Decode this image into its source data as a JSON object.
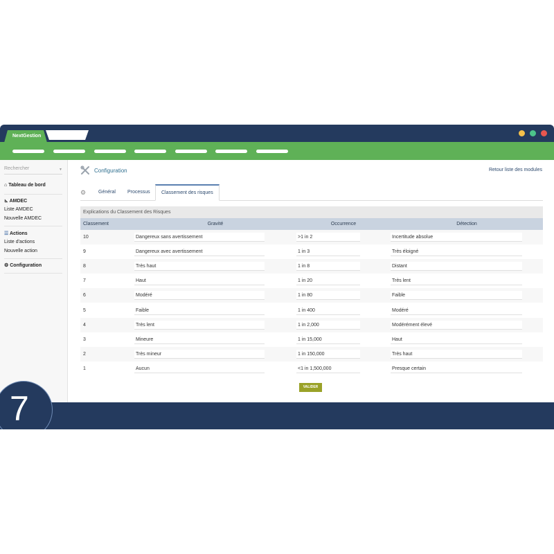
{
  "window": {
    "tab_label": "NextGestion",
    "colors": {
      "frame": "#243a5e",
      "accent": "#5fb157",
      "dot_yellow": "#f5c04a",
      "dot_green": "#4cc48a",
      "dot_red": "#e8574f"
    }
  },
  "sidebar": {
    "search_placeholder": "Rechercher",
    "dashboard": {
      "icon": "home-icon",
      "label": "Tableau de bord"
    },
    "amdec": {
      "icon": "chart-icon",
      "label": "AMDEC",
      "items": [
        "Liste AMDEC",
        "Nouvelle AMDEC"
      ]
    },
    "actions": {
      "icon": "list-icon",
      "label": "Actions",
      "items": [
        "Liste d'actions",
        "Nouvelle action"
      ]
    },
    "configuration": {
      "icon": "gear-icon",
      "label": "Configuration"
    }
  },
  "page": {
    "title": "Configuration",
    "back_link": "Retour liste des modules",
    "tabs": [
      "Général",
      "Processus",
      "Classement des risques"
    ],
    "active_tab": "Classement des risques",
    "panel_title": "Explications du Classement des Risques",
    "columns": [
      "Classement",
      "Gravité",
      "Occurrence",
      "Détection"
    ],
    "rows": [
      {
        "rank": "10",
        "gravite": "Dangereux sans avertissement",
        "occurrence": ">1 in 2",
        "detection": "Incertitude absolue"
      },
      {
        "rank": "9",
        "gravite": "Dangereux avec avertissement",
        "occurrence": "1 in 3",
        "detection": "Très éloigné"
      },
      {
        "rank": "8",
        "gravite": "Très haut",
        "occurrence": "1 in 8",
        "detection": "Distant"
      },
      {
        "rank": "7",
        "gravite": "Haut",
        "occurrence": "1 in 20",
        "detection": "Très lent"
      },
      {
        "rank": "6",
        "gravite": "Modéré",
        "occurrence": "1 in 80",
        "detection": "Faible"
      },
      {
        "rank": "5",
        "gravite": "Faible",
        "occurrence": "1 in 400",
        "detection": "Modéré"
      },
      {
        "rank": "4",
        "gravite": "Très lent",
        "occurrence": "1 in 2,000",
        "detection": "Modérément élevé"
      },
      {
        "rank": "3",
        "gravite": "Mineure",
        "occurrence": "1 in 15,000",
        "detection": "Haut"
      },
      {
        "rank": "2",
        "gravite": "Très mineur",
        "occurrence": "1 in 150,000",
        "detection": "Très haut"
      },
      {
        "rank": "1",
        "gravite": "Aucun",
        "occurrence": "<1 in 1,500,000",
        "detection": "Presque certain"
      }
    ],
    "submit_label": "VALIDER"
  },
  "badge_number": "7"
}
